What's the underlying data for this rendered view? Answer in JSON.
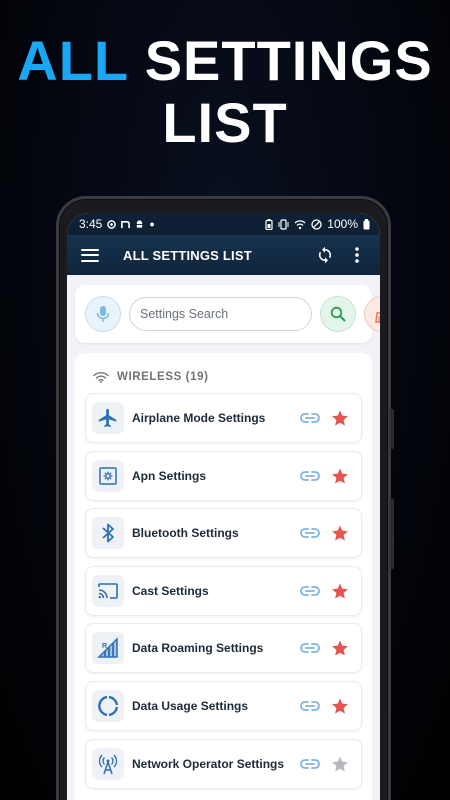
{
  "headline": {
    "line1_accent": "ALL",
    "line1_rest": "SETTINGS",
    "line2": "LIST"
  },
  "status_bar": {
    "time": "3:45",
    "battery": "100%"
  },
  "app_bar": {
    "title": "ALL SETTINGS LIST"
  },
  "search": {
    "placeholder": "Settings Search"
  },
  "section": {
    "label": "WIRELESS (19)",
    "icon": "wifi-icon"
  },
  "items": [
    {
      "label": "Airplane Mode Settings",
      "icon": "airplane-icon",
      "favorite": true
    },
    {
      "label": "Apn Settings",
      "icon": "apn-settings-icon",
      "favorite": true
    },
    {
      "label": "Bluetooth Settings",
      "icon": "bluetooth-icon",
      "favorite": true
    },
    {
      "label": "Cast Settings",
      "icon": "cast-icon",
      "favorite": true
    },
    {
      "label": "Data Roaming Settings",
      "icon": "signal-icon",
      "favorite": true
    },
    {
      "label": "Data Usage Settings",
      "icon": "data-usage-icon",
      "favorite": true
    },
    {
      "label": "Network Operator Settings",
      "icon": "antenna-icon",
      "favorite": false
    }
  ],
  "colors": {
    "accent": "#1aa7f5",
    "app_bar": "#0f253b",
    "icon_blue": "#2f6fb3",
    "star_active": "#e8524f",
    "star_inactive": "#b4b7bb",
    "link": "#7fb3df"
  }
}
